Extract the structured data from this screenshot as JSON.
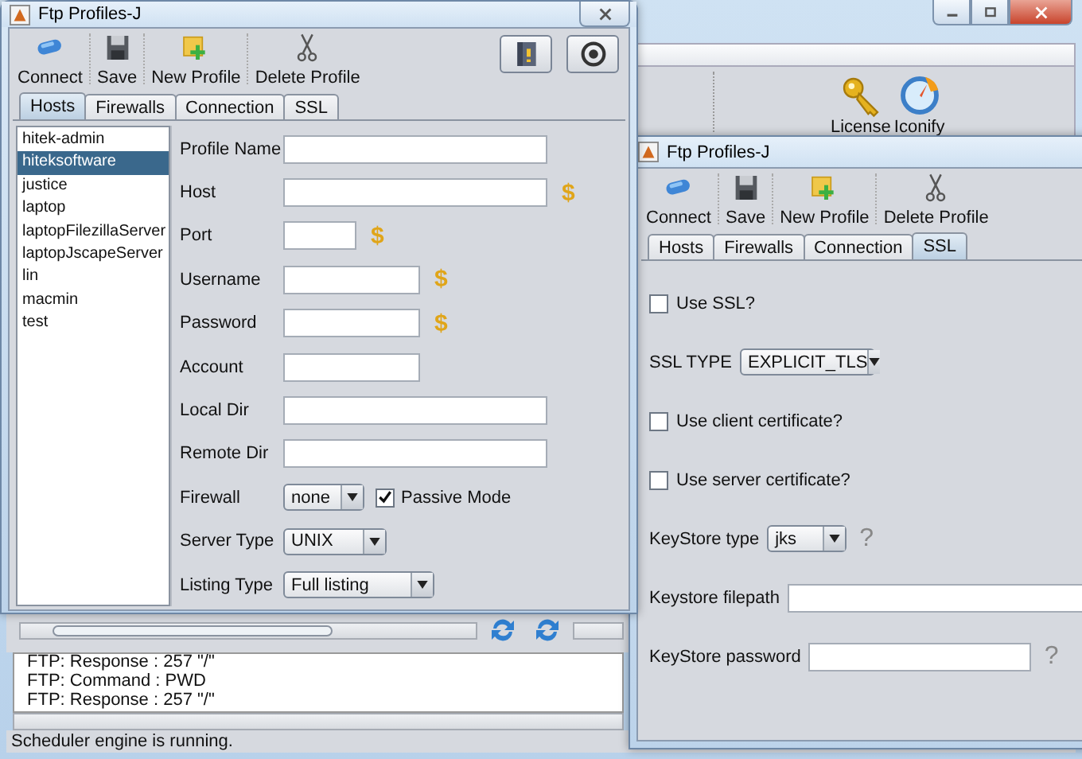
{
  "main_window": {
    "toolbar": [
      {
        "label": "License"
      },
      {
        "label": "Iconify"
      }
    ],
    "log": [
      "FTP: Response : 257 \"/\"",
      "FTP: Command : PWD",
      "FTP: Response : 257 \"/\""
    ],
    "status_bar": "Scheduler engine is running."
  },
  "hosts_window": {
    "title": "Ftp Profiles-J",
    "toolbar": [
      {
        "label": "Connect"
      },
      {
        "label": "Save"
      },
      {
        "label": "New Profile"
      },
      {
        "label": "Delete Profile"
      }
    ],
    "tabs": [
      {
        "label": "Hosts",
        "selected": true
      },
      {
        "label": "Firewalls",
        "selected": false
      },
      {
        "label": "Connection",
        "selected": false
      },
      {
        "label": "SSL",
        "selected": false
      }
    ],
    "profiles": [
      {
        "name": "hitek-admin",
        "selected": false
      },
      {
        "name": "hiteksoftware",
        "selected": true
      },
      {
        "name": "justice",
        "selected": false
      },
      {
        "name": "laptop",
        "selected": false
      },
      {
        "name": "laptopFilezillaServer",
        "selected": false
      },
      {
        "name": "laptopJscapeServer",
        "selected": false
      },
      {
        "name": "lin",
        "selected": false
      },
      {
        "name": "macmin",
        "selected": false
      },
      {
        "name": "test",
        "selected": false
      }
    ],
    "fields": [
      {
        "kind": "text",
        "label": "Profile Name"
      },
      {
        "kind": "text",
        "label": "Host",
        "variable_button": "$"
      },
      {
        "kind": "text",
        "label": "Port",
        "variable_button": "$"
      },
      {
        "kind": "text",
        "label": "Username",
        "variable_button": "$"
      },
      {
        "kind": "text",
        "label": "Password",
        "variable_button": "$"
      },
      {
        "kind": "text",
        "label": "Account"
      },
      {
        "kind": "text",
        "label": "Local Dir"
      },
      {
        "kind": "text",
        "label": "Remote Dir"
      },
      {
        "kind": "select",
        "label": "Firewall",
        "value": "none",
        "checkbox": {
          "label": "Passive Mode",
          "checked": true
        }
      },
      {
        "kind": "select",
        "label": "Server Type",
        "value": "UNIX"
      },
      {
        "kind": "select",
        "label": "Listing Type",
        "value": "Full listing"
      }
    ]
  },
  "ssl_window": {
    "title": "Ftp Profiles-J",
    "toolbar": [
      {
        "label": "Connect"
      },
      {
        "label": "Save"
      },
      {
        "label": "New Profile"
      },
      {
        "label": "Delete Profile"
      }
    ],
    "tabs": [
      {
        "label": "Hosts",
        "selected": false
      },
      {
        "label": "Firewalls",
        "selected": false
      },
      {
        "label": "Connection",
        "selected": false
      },
      {
        "label": "SSL",
        "selected": true
      }
    ],
    "rows": [
      {
        "kind": "checkbox",
        "label": "Use SSL?",
        "checked": false
      },
      {
        "kind": "select",
        "label": "SSL TYPE",
        "value": "EXPLICIT_TLS"
      },
      {
        "kind": "checkbox",
        "label": "Use client certificate?",
        "checked": false
      },
      {
        "kind": "checkbox",
        "label": "Use server certificate?",
        "checked": false
      },
      {
        "kind": "select",
        "label": "KeyStore type",
        "value": "jks",
        "help": "?"
      },
      {
        "kind": "text",
        "label": "Keystore filepath"
      },
      {
        "kind": "text",
        "label": "KeyStore password",
        "help": "?"
      }
    ]
  }
}
